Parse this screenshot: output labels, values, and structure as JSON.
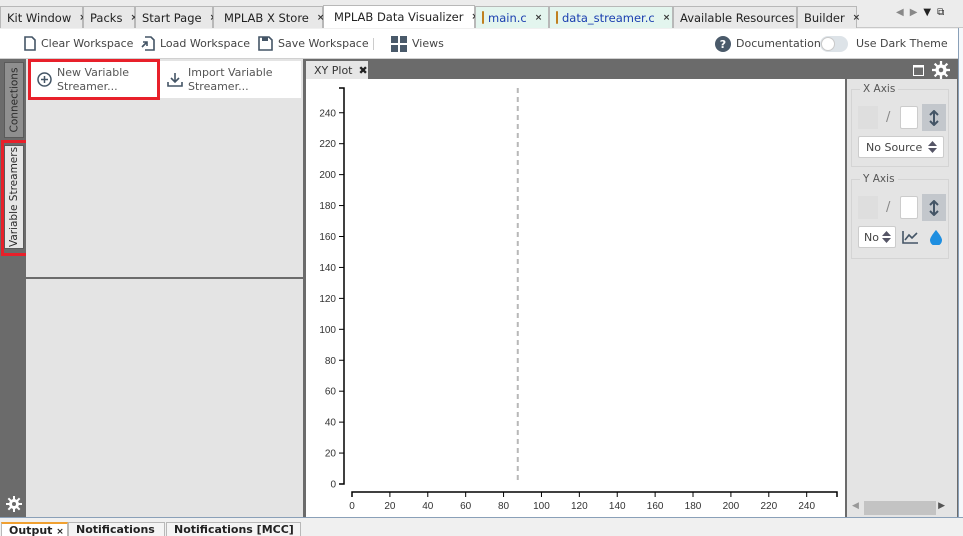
{
  "tabs": [
    {
      "label": "Kit Window",
      "active": false
    },
    {
      "label": "Packs",
      "active": false
    },
    {
      "label": "Start Page",
      "active": false
    },
    {
      "label": "MPLAB X Store",
      "active": false,
      "icon": "cart-icon"
    },
    {
      "label": "MPLAB Data Visualizer",
      "active": true,
      "icon": "data-visualizer-icon"
    },
    {
      "label": "main.c",
      "active": false,
      "icon": "c-file-icon"
    },
    {
      "label": "data_streamer.c",
      "active": false,
      "icon": "c-file-icon"
    },
    {
      "label": "Available Resources",
      "active": false
    },
    {
      "label": "Builder",
      "active": false
    }
  ],
  "tab_close_glyph": "×",
  "tab_nav": {
    "left": "◀",
    "right": "▶",
    "menu": "▼",
    "maximize": "⧉"
  },
  "toolbar": {
    "clear_workspace": "Clear Workspace",
    "load_workspace": "Load Workspace",
    "save_workspace": "Save Workspace",
    "views": "Views",
    "documentation": "Documentation",
    "dark_theme": "Use Dark Theme",
    "dark_theme_on": false
  },
  "left_strip": {
    "connections": "Connections",
    "variable_streamers": "Variable Streamers"
  },
  "streamer_panel": {
    "new_variable_streamer": [
      "New Variable",
      "Streamer..."
    ],
    "import_variable_streamer": [
      "Import Variable",
      "Streamer..."
    ]
  },
  "plot": {
    "tab_label": "XY Plot",
    "close_glyph": "✖"
  },
  "settings": {
    "x_axis": {
      "title": "X Axis",
      "slash": "/",
      "source": "No Source"
    },
    "y_axis": {
      "title": "Y Axis",
      "slash": "/",
      "source": "No"
    }
  },
  "bottom_tabs": [
    {
      "label": "Output",
      "active": true
    },
    {
      "label": "Notifications",
      "active": false
    },
    {
      "label": "Notifications [MCC]",
      "active": false
    }
  ],
  "chart_data": {
    "type": "line",
    "title": "",
    "xlabel": "",
    "ylabel": "",
    "xlim": [
      0,
      256
    ],
    "ylim": [
      0,
      256
    ],
    "x_ticks": [
      0,
      20,
      40,
      60,
      80,
      100,
      120,
      140,
      160,
      180,
      200,
      220,
      240
    ],
    "y_ticks": [
      0,
      20,
      40,
      60,
      80,
      100,
      120,
      140,
      160,
      180,
      200,
      220,
      240
    ],
    "series": [],
    "cursor_x": 87.5,
    "grid": false
  }
}
